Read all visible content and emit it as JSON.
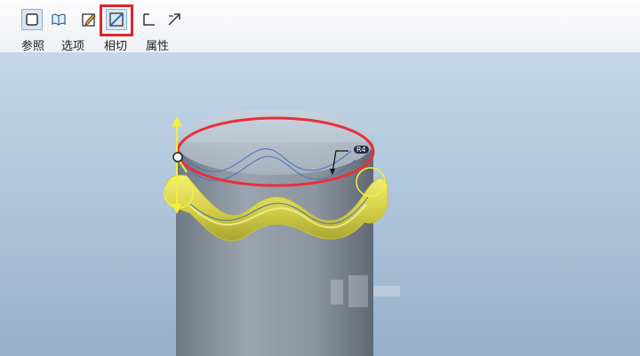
{
  "toolbar": {
    "buttons": [
      {
        "id": "references",
        "label": "参照",
        "icon": "square-icon",
        "pressed": true
      },
      {
        "id": "options",
        "label": "选项",
        "icon": "open-book-icon",
        "pressed": false
      },
      {
        "id": "sketch",
        "label": "",
        "icon": "pencil-sketch-icon",
        "pressed": false
      },
      {
        "id": "tangent",
        "label": "相切",
        "icon": "tangent-diagonal-icon",
        "pressed": true
      },
      {
        "id": "properties",
        "label": "属性",
        "icon": "corner-bracket-icon",
        "pressed": false
      },
      {
        "id": "flip",
        "label": "",
        "icon": "diagonal-arrow-icon",
        "pressed": false
      }
    ],
    "highlight_color": "#e0252b"
  },
  "viewport": {
    "dimension_tag": "R4",
    "colors": {
      "cylinder": "#8e9aa6",
      "sweep": "#dada55",
      "highlight_ellipse": "#e8303a",
      "handle": "#f5ee3a"
    }
  }
}
